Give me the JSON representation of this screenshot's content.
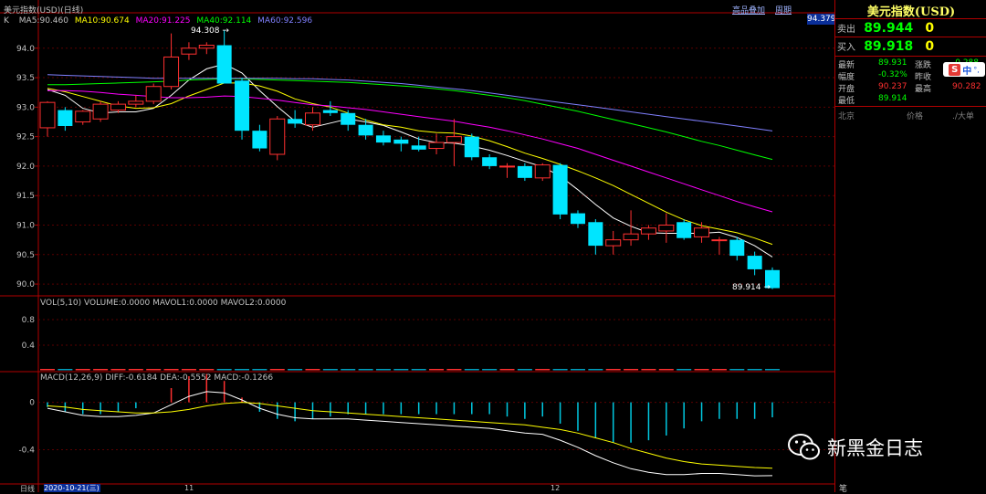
{
  "header": {
    "title_prefix": "K",
    "title": "美元指数(USD)(日线)",
    "ma5": "MA5:90.460",
    "ma10": "MA10:90.674",
    "ma20": "MA20:91.225",
    "ma40": "MA40:92.114",
    "ma60": "MA60:92.596",
    "link1": "高品叠加",
    "link2": "周期",
    "price_tag": "94.379",
    "colors": {
      "ma5": "#ffffff",
      "ma10": "#ffff00",
      "ma20": "#ff00ff",
      "ma40": "#00ff00",
      "ma60": "#8080ff"
    }
  },
  "vol": {
    "label": "VOL(5,10) VOLUME:0.0000 MAVOL1:0.0000 MAVOL2:0.0000",
    "ticks": [
      "0.8",
      "0.4"
    ]
  },
  "macd": {
    "label": "MACD(12,26,9) DIFF:-0.6184 DEA:-0.5552 MACD:-0.1266",
    "ticks": [
      "0",
      "-0.4"
    ]
  },
  "xaxis": {
    "left_label": "日线",
    "date": "2020-10-21(三)",
    "t1": "11",
    "t2": "12"
  },
  "annotations": {
    "high": "94.308",
    "low": "89.914"
  },
  "quote": {
    "title": "美元指数(USD)",
    "sell_label": "卖出",
    "sell": "89.944",
    "sell_vol": "0",
    "buy_label": "买入",
    "buy": "89.918",
    "buy_vol": "0",
    "latest_label": "最新",
    "latest": "89.931",
    "change_label": "涨跌",
    "change": "-0.288",
    "amp_label": "幅度",
    "amp": "-0.32%",
    "prev_label": "昨收",
    "open_label": "开盘",
    "open": "90.237",
    "high_label": "最高",
    "high": "90.282",
    "low_label": "最低",
    "low": "89.914",
    "tz": "北京",
    "price_col": "价格",
    "lot_col": "./大单",
    "bottom_char": "笔"
  },
  "watermark": {
    "text": "新黑金日志",
    "icon": "wechat-icon"
  },
  "chart_data": {
    "type": "candlestick",
    "ylim": [
      89.8,
      94.6
    ],
    "yticks": [
      94.0,
      93.5,
      93.0,
      92.5,
      92.0,
      91.5,
      91.0,
      90.5,
      90.0
    ],
    "candles": [
      {
        "o": 92.65,
        "h": 93.1,
        "l": 92.5,
        "c": 93.08
      },
      {
        "o": 92.95,
        "h": 93.0,
        "l": 92.6,
        "c": 92.68
      },
      {
        "o": 92.75,
        "h": 92.95,
        "l": 92.7,
        "c": 92.93
      },
      {
        "o": 92.8,
        "h": 93.1,
        "l": 92.75,
        "c": 93.05
      },
      {
        "o": 92.95,
        "h": 93.1,
        "l": 92.9,
        "c": 93.05
      },
      {
        "o": 93.05,
        "h": 93.2,
        "l": 93.0,
        "c": 93.1
      },
      {
        "o": 93.1,
        "h": 93.4,
        "l": 93.05,
        "c": 93.35
      },
      {
        "o": 93.35,
        "h": 94.25,
        "l": 93.3,
        "c": 93.85
      },
      {
        "o": 93.9,
        "h": 94.1,
        "l": 93.8,
        "c": 94.0
      },
      {
        "o": 94.0,
        "h": 94.1,
        "l": 93.9,
        "c": 94.05
      },
      {
        "o": 94.05,
        "h": 94.308,
        "l": 93.7,
        "c": 93.4
      },
      {
        "o": 93.45,
        "h": 93.5,
        "l": 92.45,
        "c": 92.6
      },
      {
        "o": 92.6,
        "h": 92.7,
        "l": 92.25,
        "c": 92.3
      },
      {
        "o": 92.2,
        "h": 92.85,
        "l": 92.1,
        "c": 92.8
      },
      {
        "o": 92.8,
        "h": 92.95,
        "l": 92.65,
        "c": 92.72
      },
      {
        "o": 92.7,
        "h": 93.0,
        "l": 92.6,
        "c": 92.9
      },
      {
        "o": 92.95,
        "h": 93.1,
        "l": 92.85,
        "c": 92.9
      },
      {
        "o": 92.9,
        "h": 92.95,
        "l": 92.6,
        "c": 92.7
      },
      {
        "o": 92.7,
        "h": 92.8,
        "l": 92.45,
        "c": 92.52
      },
      {
        "o": 92.52,
        "h": 92.6,
        "l": 92.35,
        "c": 92.4
      },
      {
        "o": 92.45,
        "h": 92.5,
        "l": 92.25,
        "c": 92.38
      },
      {
        "o": 92.35,
        "h": 92.5,
        "l": 92.25,
        "c": 92.28
      },
      {
        "o": 92.3,
        "h": 92.55,
        "l": 92.2,
        "c": 92.4
      },
      {
        "o": 92.4,
        "h": 92.8,
        "l": 92.0,
        "c": 92.5
      },
      {
        "o": 92.5,
        "h": 92.55,
        "l": 92.1,
        "c": 92.15
      },
      {
        "o": 92.15,
        "h": 92.2,
        "l": 91.95,
        "c": 92.0
      },
      {
        "o": 92.0,
        "h": 92.05,
        "l": 91.8,
        "c": 92.0
      },
      {
        "o": 92.0,
        "h": 92.05,
        "l": 91.75,
        "c": 91.8
      },
      {
        "o": 91.8,
        "h": 92.05,
        "l": 91.75,
        "c": 92.02
      },
      {
        "o": 92.02,
        "h": 92.05,
        "l": 91.1,
        "c": 91.18
      },
      {
        "o": 91.2,
        "h": 91.25,
        "l": 90.95,
        "c": 91.02
      },
      {
        "o": 91.05,
        "h": 91.1,
        "l": 90.5,
        "c": 90.65
      },
      {
        "o": 90.65,
        "h": 90.9,
        "l": 90.5,
        "c": 90.75
      },
      {
        "o": 90.75,
        "h": 91.25,
        "l": 90.65,
        "c": 90.85
      },
      {
        "o": 90.85,
        "h": 91.0,
        "l": 90.75,
        "c": 90.95
      },
      {
        "o": 90.9,
        "h": 91.2,
        "l": 90.7,
        "c": 91.0
      },
      {
        "o": 91.05,
        "h": 91.1,
        "l": 90.75,
        "c": 90.78
      },
      {
        "o": 90.8,
        "h": 91.05,
        "l": 90.7,
        "c": 90.95
      },
      {
        "o": 90.75,
        "h": 90.8,
        "l": 90.5,
        "c": 90.75
      },
      {
        "o": 90.75,
        "h": 90.8,
        "l": 90.4,
        "c": 90.48
      },
      {
        "o": 90.48,
        "h": 90.55,
        "l": 90.15,
        "c": 90.25
      },
      {
        "o": 90.237,
        "h": 90.282,
        "l": 89.914,
        "c": 89.931
      }
    ],
    "ma": [
      {
        "name": "MA5",
        "color": "#ffffff",
        "values": [
          93.3,
          93.2,
          92.98,
          92.9,
          92.92,
          92.92,
          92.98,
          93.2,
          93.46,
          93.65,
          93.73,
          93.58,
          93.28,
          93.01,
          92.76,
          92.66,
          92.73,
          92.8,
          92.75,
          92.69,
          92.58,
          92.46,
          92.4,
          92.39,
          92.34,
          92.27,
          92.18,
          92.08,
          91.99,
          91.83,
          91.6,
          91.35,
          91.12,
          90.98,
          90.87,
          90.86,
          90.86,
          90.86,
          90.88,
          90.79,
          90.65,
          90.46
        ]
      },
      {
        "name": "MA10",
        "color": "#ffff00",
        "values": [
          93.32,
          93.26,
          93.18,
          93.1,
          93.02,
          92.98,
          92.99,
          93.06,
          93.19,
          93.3,
          93.41,
          93.41,
          93.36,
          93.27,
          93.14,
          93.06,
          93.0,
          92.9,
          92.78,
          92.7,
          92.66,
          92.6,
          92.57,
          92.56,
          92.51,
          92.43,
          92.33,
          92.22,
          92.13,
          92.03,
          91.92,
          91.8,
          91.67,
          91.52,
          91.37,
          91.22,
          91.09,
          90.99,
          90.93,
          90.87,
          90.78,
          90.674
        ]
      },
      {
        "name": "MA20",
        "color": "#ff00ff",
        "values": [
          93.28,
          93.28,
          93.27,
          93.25,
          93.22,
          93.2,
          93.18,
          93.16,
          93.16,
          93.17,
          93.19,
          93.18,
          93.15,
          93.12,
          93.08,
          93.04,
          93.02,
          92.99,
          92.96,
          92.92,
          92.88,
          92.84,
          92.8,
          92.76,
          92.71,
          92.66,
          92.6,
          92.53,
          92.46,
          92.38,
          92.3,
          92.2,
          92.1,
          92.0,
          91.9,
          91.8,
          91.7,
          91.6,
          91.5,
          91.4,
          91.31,
          91.225
        ]
      },
      {
        "name": "MA40",
        "color": "#00ff00",
        "values": [
          93.38,
          93.38,
          93.39,
          93.4,
          93.41,
          93.42,
          93.43,
          93.44,
          93.46,
          93.47,
          93.48,
          93.48,
          93.47,
          93.46,
          93.45,
          93.44,
          93.43,
          93.42,
          93.4,
          93.38,
          93.36,
          93.34,
          93.31,
          93.28,
          93.24,
          93.2,
          93.16,
          93.11,
          93.05,
          92.99,
          92.93,
          92.86,
          92.79,
          92.72,
          92.65,
          92.58,
          92.5,
          92.42,
          92.35,
          92.27,
          92.19,
          92.114
        ]
      },
      {
        "name": "MA60",
        "color": "#8080ff",
        "values": [
          93.55,
          93.54,
          93.53,
          93.52,
          93.51,
          93.5,
          93.49,
          93.49,
          93.49,
          93.49,
          93.49,
          93.49,
          93.49,
          93.49,
          93.48,
          93.48,
          93.47,
          93.46,
          93.44,
          93.42,
          93.4,
          93.37,
          93.34,
          93.31,
          93.28,
          93.24,
          93.2,
          93.16,
          93.12,
          93.08,
          93.04,
          93.0,
          92.96,
          92.92,
          92.88,
          92.84,
          92.8,
          92.76,
          92.72,
          92.68,
          92.64,
          92.596
        ]
      }
    ],
    "macd": {
      "ylim": [
        -0.65,
        0.22
      ],
      "diff": [
        -0.05,
        -0.08,
        -0.11,
        -0.12,
        -0.12,
        -0.11,
        -0.09,
        -0.02,
        0.05,
        0.09,
        0.08,
        0.02,
        -0.05,
        -0.1,
        -0.13,
        -0.14,
        -0.14,
        -0.14,
        -0.15,
        -0.16,
        -0.17,
        -0.18,
        -0.19,
        -0.2,
        -0.21,
        -0.22,
        -0.24,
        -0.26,
        -0.27,
        -0.32,
        -0.38,
        -0.45,
        -0.51,
        -0.56,
        -0.59,
        -0.61,
        -0.61,
        -0.6,
        -0.6,
        -0.61,
        -0.62,
        -0.6184
      ],
      "dea": [
        -0.03,
        -0.04,
        -0.06,
        -0.07,
        -0.08,
        -0.09,
        -0.09,
        -0.08,
        -0.06,
        -0.03,
        -0.01,
        0.0,
        -0.01,
        -0.03,
        -0.05,
        -0.07,
        -0.08,
        -0.09,
        -0.1,
        -0.11,
        -0.12,
        -0.13,
        -0.14,
        -0.15,
        -0.16,
        -0.17,
        -0.18,
        -0.19,
        -0.21,
        -0.23,
        -0.26,
        -0.3,
        -0.34,
        -0.39,
        -0.43,
        -0.47,
        -0.5,
        -0.52,
        -0.53,
        -0.54,
        -0.55,
        -0.5552
      ],
      "hist": [
        -0.04,
        -0.08,
        -0.1,
        -0.1,
        -0.08,
        -0.05,
        0.0,
        0.12,
        0.22,
        0.24,
        0.18,
        0.04,
        -0.08,
        -0.14,
        -0.16,
        -0.14,
        -0.12,
        -0.1,
        -0.1,
        -0.1,
        -0.1,
        -0.1,
        -0.1,
        -0.1,
        -0.1,
        -0.1,
        -0.12,
        -0.14,
        -0.12,
        -0.18,
        -0.24,
        -0.3,
        -0.34,
        -0.34,
        -0.32,
        -0.28,
        -0.22,
        -0.16,
        -0.14,
        -0.14,
        -0.14,
        -0.1266
      ]
    }
  }
}
